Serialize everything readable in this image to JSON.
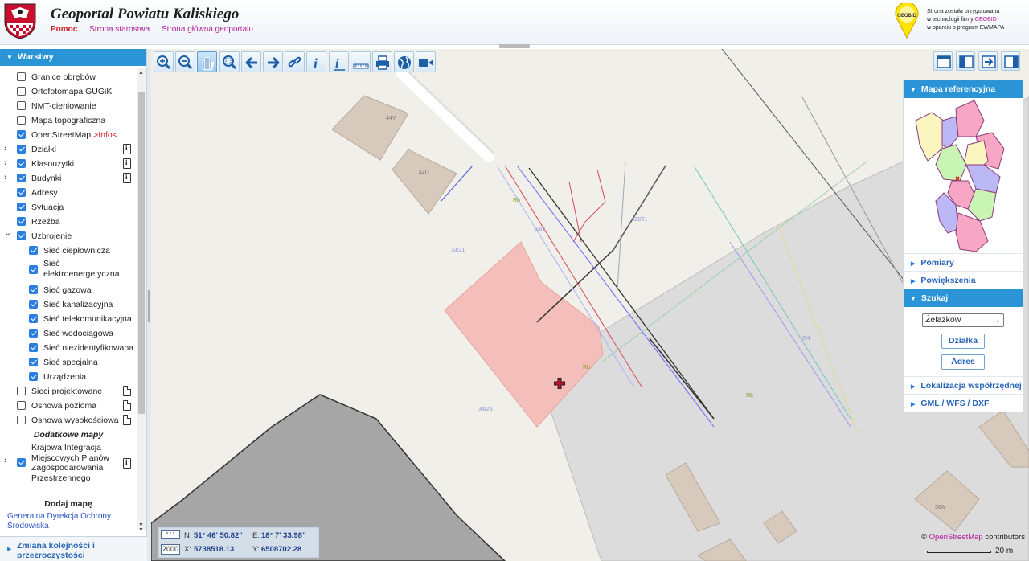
{
  "header": {
    "title": "Geoportal Powiatu Kaliskiego",
    "nav": [
      "Pomoc",
      "Strona starostwa",
      "Strona główna geoportalu"
    ],
    "geobid_logo_text": "GEOBID",
    "credit_line1": "Strona została przygotowana",
    "credit_line2_pre": "w technologii firmy ",
    "credit_line2_brand": "GEOBID",
    "credit_line3": "w oparciu o program EWMAPA"
  },
  "layers_panel": {
    "title": "Warstwy",
    "items": [
      {
        "label": "Granice obrębów",
        "checked": false,
        "expand": false,
        "icon": "none",
        "indent": 0
      },
      {
        "label": "Ortofotomapa GUGiK",
        "checked": false,
        "expand": false,
        "icon": "none",
        "indent": 0
      },
      {
        "label": "NMT-cieniowanie",
        "checked": false,
        "expand": false,
        "icon": "none",
        "indent": 0
      },
      {
        "label": "Mapa topograficzna",
        "checked": false,
        "expand": false,
        "icon": "none",
        "indent": 0
      },
      {
        "label": "OpenStreetMap",
        "suffix": ">Info<",
        "checked": true,
        "expand": false,
        "icon": "none",
        "indent": 0
      },
      {
        "label": "Działki",
        "checked": true,
        "expand": "collapsed",
        "icon": "info-icon",
        "indent": 0
      },
      {
        "label": "Klasoużytki",
        "checked": true,
        "expand": "collapsed",
        "icon": "info-icon",
        "indent": 0
      },
      {
        "label": "Budynki",
        "checked": true,
        "expand": "collapsed",
        "icon": "info-icon",
        "indent": 0
      },
      {
        "label": "Adresy",
        "checked": true,
        "expand": false,
        "icon": "none",
        "indent": 0
      },
      {
        "label": "Sytuacja",
        "checked": true,
        "expand": false,
        "icon": "none",
        "indent": 0
      },
      {
        "label": "Rzeźba",
        "checked": true,
        "expand": false,
        "icon": "none",
        "indent": 0
      },
      {
        "label": "Uzbrojenie",
        "checked": true,
        "expand": "expanded",
        "icon": "none",
        "indent": 0
      },
      {
        "label": "Sieć ciepłownicza",
        "checked": true,
        "expand": false,
        "icon": "none",
        "indent": 1
      },
      {
        "label": "Sieć elektroenergetyczna",
        "checked": true,
        "expand": false,
        "icon": "none",
        "indent": 1,
        "lines": 2
      },
      {
        "label": "Sieć gazowa",
        "checked": true,
        "expand": false,
        "icon": "none",
        "indent": 1
      },
      {
        "label": "Sieć kanalizacyjna",
        "checked": true,
        "expand": false,
        "icon": "none",
        "indent": 1
      },
      {
        "label": "Sieć telekomunikacyjna",
        "checked": true,
        "expand": false,
        "icon": "none",
        "indent": 1
      },
      {
        "label": "Sieć wodociągowa",
        "checked": true,
        "expand": false,
        "icon": "none",
        "indent": 1
      },
      {
        "label": "Sieć niezidentyfikowana",
        "checked": true,
        "expand": false,
        "icon": "none",
        "indent": 1
      },
      {
        "label": "Sieć specjalna",
        "checked": true,
        "expand": false,
        "icon": "none",
        "indent": 1
      },
      {
        "label": "Urządzenia",
        "checked": true,
        "expand": false,
        "icon": "none",
        "indent": 1
      },
      {
        "label": "Sieci projektowane",
        "checked": false,
        "expand": false,
        "icon": "doc-icon",
        "indent": 0
      },
      {
        "label": "Osnowa pozioma",
        "checked": false,
        "expand": false,
        "icon": "doc-icon",
        "indent": 0
      },
      {
        "label": "Osnowa wysokościowa",
        "checked": false,
        "expand": false,
        "icon": "doc-icon",
        "indent": 0
      }
    ],
    "extra_maps_heading": "Dodatkowe mapy",
    "extra_map_item": {
      "label": "Krajowa Integracja Miejscowych Planów Zagospodarowania Przestrzennego",
      "checked": true,
      "expand": "collapsed",
      "icon": "info-icon"
    },
    "add_map_heading": "Dodaj mapę",
    "add_map_link": "Generalna Dyrekcja Ochrony Środowiska",
    "bottom_section": "Zmiana kolejności i przezroczystości"
  },
  "toolbar": {
    "buttons": [
      "zoom-in-icon",
      "zoom-out-icon",
      "pan-hand-icon",
      "zoom-window-icon",
      "back-arrow-icon",
      "forward-arrow-icon",
      "link-icon",
      "info-icon",
      "info-list-icon",
      "measure-ruler-icon",
      "print-icon",
      "globe-icon",
      "video-icon"
    ],
    "active": "pan-hand-icon"
  },
  "layout_buttons": [
    "layout-full-icon",
    "layout-left-panel-icon",
    "export-icon",
    "layout-right-panel-icon"
  ],
  "right_panel": {
    "ref_map_title": "Mapa referencyjna",
    "sections": [
      "Pomiary",
      "Powiększenia"
    ],
    "search_title": "Szukaj",
    "search_select": "Żelazków",
    "search_buttons": [
      "Działka",
      "Adres"
    ],
    "more_sections": [
      "Lokalizacja współrzędnej",
      "GML / WFS / DXF"
    ]
  },
  "map": {
    "labels": {
      "b1": "44Y",
      "b2": "44U",
      "b3": "36A",
      "p1": "33/21",
      "p2": "33/21",
      "p3": "33/7",
      "p4": "34/25",
      "p5": "8/4",
      "p6": "Rb",
      "p7": "Rb",
      "p8": "Rb"
    },
    "colors": {
      "background": "#f1efe9",
      "selected_parcel": "#f4bfba",
      "building": "#d7c9bc",
      "dark_area": "#a6a6a6",
      "gray_area": "#dcdcdc"
    }
  },
  "coordinates": {
    "format_button": "° ' \"",
    "epsg_button": "2000",
    "n_label": "N:",
    "n_value": "51° 46' 50.82\"",
    "e_label": "E:",
    "e_value": "18° 7' 33.98\"",
    "x_label": "X:",
    "x_value": "5738518.13",
    "y_label": "Y:",
    "y_value": "6508702.28"
  },
  "attribution": {
    "prefix": "©",
    "link": "OpenStreetMap",
    "suffix": "contributors"
  },
  "scale": {
    "label": "20 m"
  }
}
